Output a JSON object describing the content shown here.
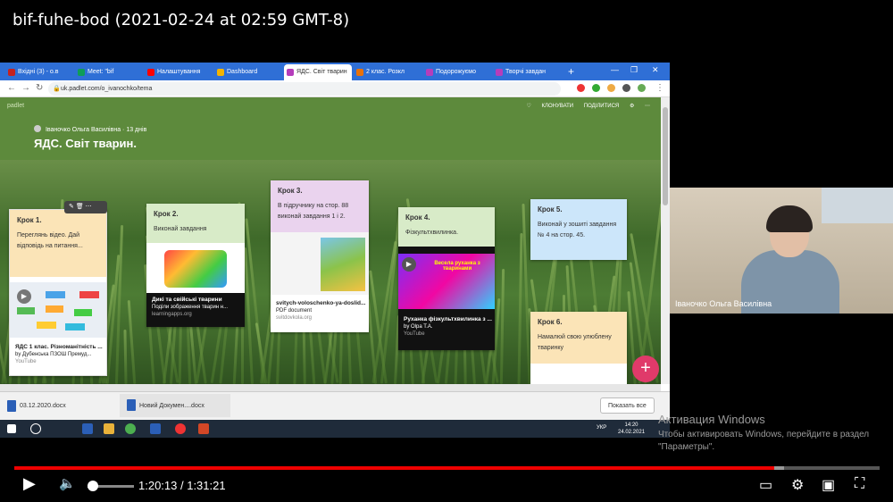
{
  "video": {
    "title": "bif-fuhe-bod (2021-02-24 at 02:59 GMT-8)"
  },
  "browser": {
    "tabs": [
      {
        "label": "Вхідні (3) - о.в",
        "color": "#c5221f"
      },
      {
        "label": "Meet: \"bif",
        "color": "#0f9d58"
      },
      {
        "label": "Налаштування",
        "color": "#ff0000"
      },
      {
        "label": "Dashboard",
        "color": "#f4b400"
      },
      {
        "label": "ЯДС. Світ тварин",
        "color": "#b53dbb",
        "active": true
      },
      {
        "label": "2 клас. Розкл",
        "color": "#e8710a"
      },
      {
        "label": "Подорожуємо",
        "color": "#b53dbb"
      },
      {
        "label": "Творчі завдан",
        "color": "#b53dbb"
      }
    ],
    "new_tab": "+",
    "url": "uk.padlet.com/o_ivanochko/tema"
  },
  "padlet": {
    "brand": "padlet",
    "actions": [
      "♡",
      "КЛОНУВАТИ",
      "ПОДІЛИТИСЯ",
      "⚙",
      "⋯"
    ],
    "author": "Іваночко Ольга Василівна",
    "age": "13 днів",
    "title": "ЯДС. Світ тварин.",
    "cards": [
      {
        "head": "Крок 1.",
        "body": "Переглянь відео. Дай відповідь на питання...",
        "cap_title": "ЯДС 1 клас. Різноманітність ...",
        "cap_sub": "by Дубенська ПЗОШ Премуд...",
        "cap_src": "YouTube"
      },
      {
        "head": "Крок 2.",
        "body": "Виконай завдання",
        "cap_title": "Дикі та свійські тварини",
        "cap_sub": "Поділи зображення тварин н...",
        "cap_src": "learningapps.org"
      },
      {
        "head": "Крок 3.",
        "body": "В підручнику на стор. 88 виконай завдання 1 і 2.",
        "cap_title": "svitych-voloschenko-ya-doslid...",
        "cap_sub": "PDF document",
        "cap_src": "svitdovkola.org"
      },
      {
        "head": "Крок 4.",
        "body": "Фізкультхвилинка.",
        "cap_title": "Руханка фізкультхвилинка з ...",
        "cap_sub": "by Olpa T.A.",
        "cap_src": "YouTube",
        "thumb_text": "Весела руханка з тваринами"
      },
      {
        "head": "Крок 5.",
        "body": "Виконай у зошиті завдання № 4 на стор. 45."
      },
      {
        "head": "Крок 6.",
        "body": "Намалюй свою улюблену тваринку"
      }
    ],
    "add": "+"
  },
  "downloads": [
    {
      "label": "03.12.2020.docx"
    },
    {
      "label": "Новий Докумен....docx"
    }
  ],
  "downloads_show_all": "Показать все",
  "taskbar": {
    "lang": "УКР",
    "time": "14:20",
    "date": "24.02.2021"
  },
  "webcam": {
    "name": "Іваночко Ольга Василівна"
  },
  "windows_activation": {
    "title": "Активация Windows",
    "text": "Чтобы активировать Windows, перейдите в раздел \"Параметры\"."
  },
  "player": {
    "time": "1:20:13 / 1:31:21",
    "progress": 0.878,
    "buffered": 0.89,
    "volume": 0.12
  }
}
